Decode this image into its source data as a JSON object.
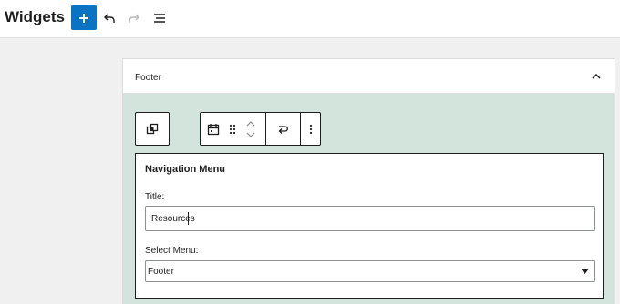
{
  "header": {
    "title": "Widgets",
    "icons": [
      "plus-icon",
      "undo-icon",
      "redo-icon",
      "list-view-icon"
    ]
  },
  "panel": {
    "title": "Footer",
    "collapse_icon": "chevron-up-icon"
  },
  "toolbar": {
    "icons": [
      "transform-icon",
      "calendar-icon",
      "drag-handle-icon",
      "move-up-icon",
      "move-down-icon",
      "loop-icon",
      "more-options-icon"
    ]
  },
  "form": {
    "heading": "Navigation Menu",
    "title_label": "Title:",
    "title_value": "Resources",
    "select_label": "Select Menu:",
    "select_value": "Footer"
  },
  "colors": {
    "accent": "#0a73c4",
    "panel_body_bg": "#d3e4dd",
    "page_bg": "#f0f0f1"
  }
}
